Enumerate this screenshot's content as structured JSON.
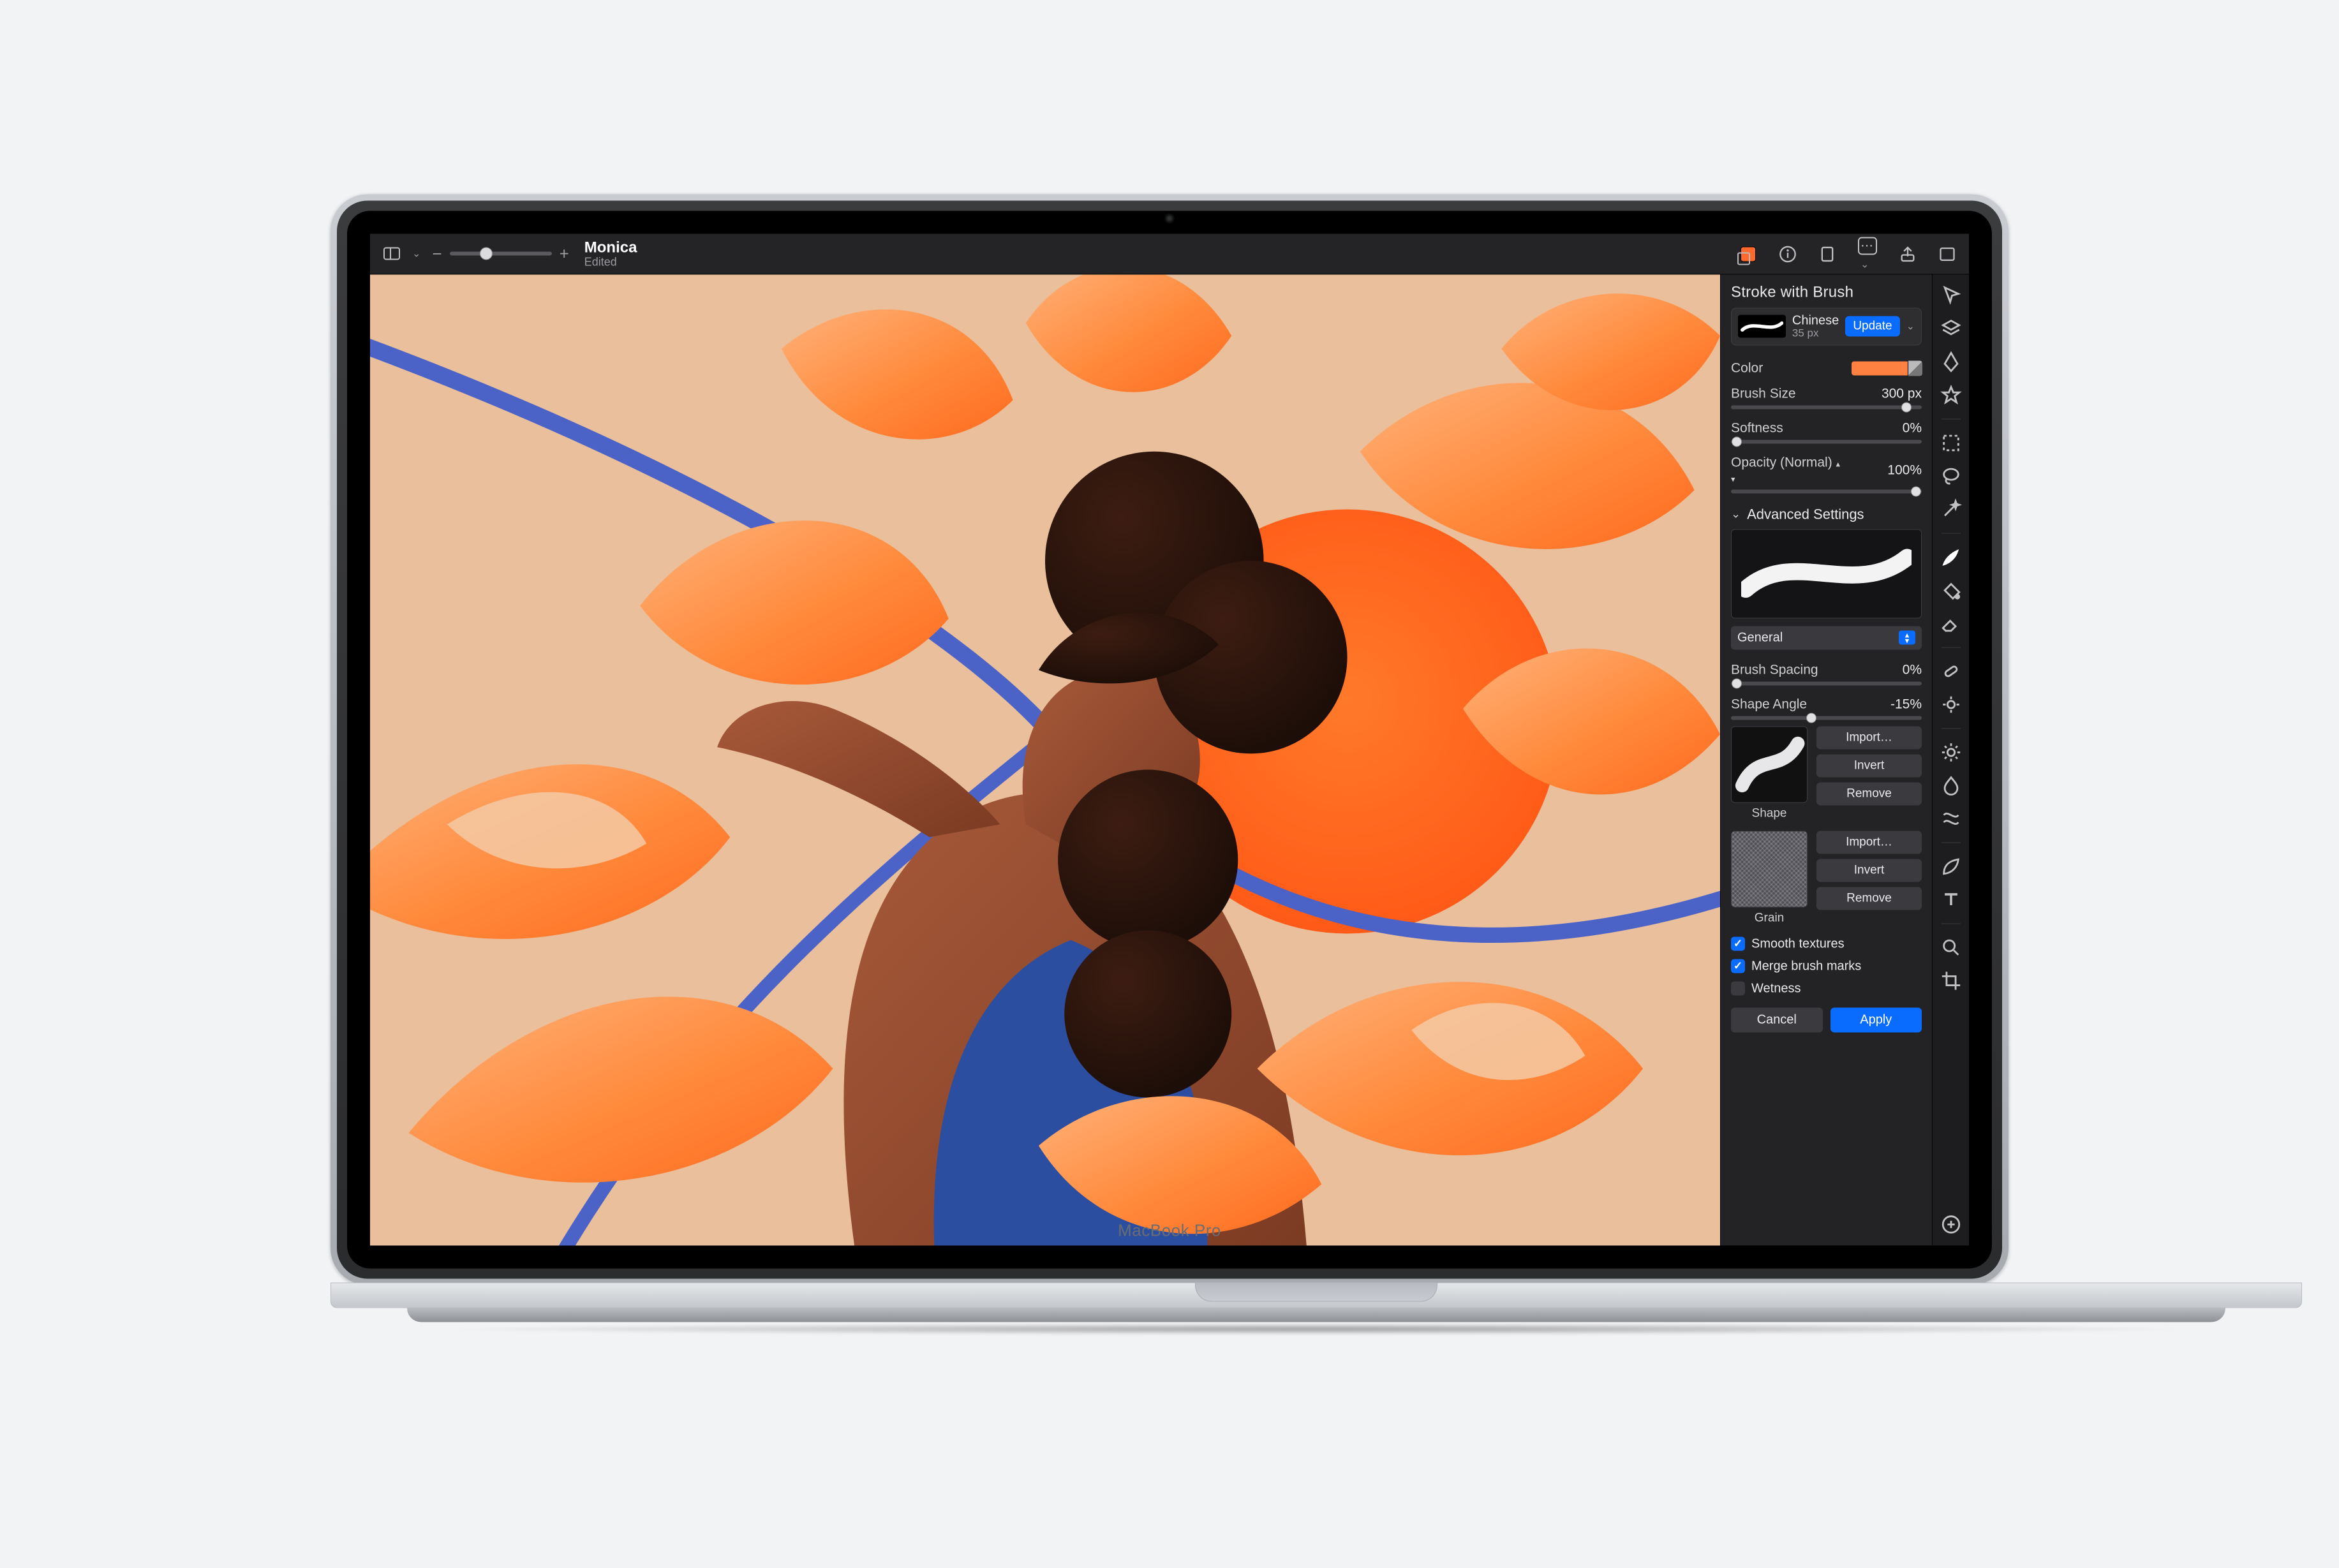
{
  "device": {
    "brand": "MacBook Pro"
  },
  "header": {
    "doc_name": "Monica",
    "doc_status": "Edited",
    "zoom": {
      "minus": "−",
      "plus": "+"
    }
  },
  "panel": {
    "title": "Stroke with Brush",
    "brush": {
      "name": "Chinese",
      "size_label": "35 px",
      "update": "Update"
    },
    "color_label": "Color",
    "color_hex": "#ff8142",
    "brush_size": {
      "label": "Brush Size",
      "value": "300 px",
      "pct": 92
    },
    "softness": {
      "label": "Softness",
      "value": "0%",
      "pct": 0
    },
    "opacity": {
      "label": "Opacity (Normal)",
      "value": "100%",
      "pct": 100
    },
    "advanced_label": "Advanced Settings",
    "category": "General",
    "brush_spacing": {
      "label": "Brush Spacing",
      "value": "0%",
      "pct": 0
    },
    "shape_angle": {
      "label": "Shape Angle",
      "value": "-15%",
      "pct": 42
    },
    "shape_label": "Shape",
    "grain_label": "Grain",
    "btn_import": "Import…",
    "btn_invert": "Invert",
    "btn_remove": "Remove",
    "check_smooth": "Smooth textures",
    "check_merge": "Merge brush marks",
    "check_wetness": "Wetness",
    "cancel": "Cancel",
    "apply": "Apply"
  }
}
